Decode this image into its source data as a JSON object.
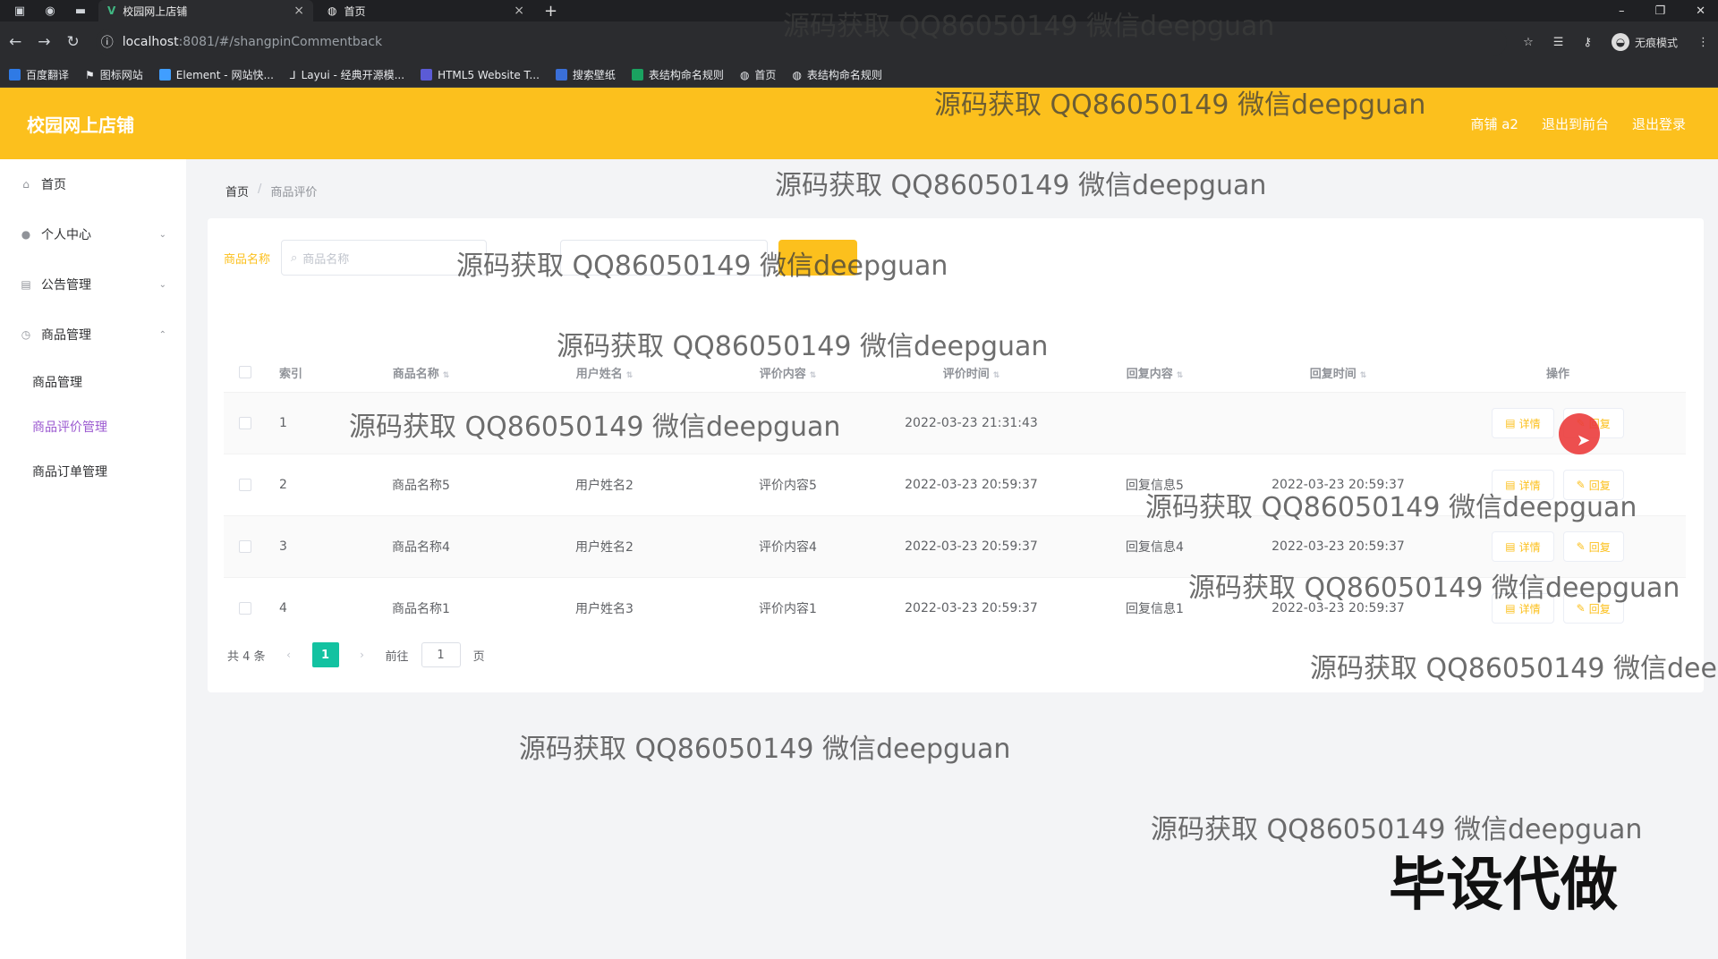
{
  "browser": {
    "tabs": [
      {
        "label": "校园网上店铺",
        "active": true
      },
      {
        "label": "首页",
        "active": false
      }
    ],
    "url_host": "localhost",
    "url_path": ":8081/#/shangpinCommentback",
    "incognito_label": "无痕模式",
    "bookmarks": [
      "百度翻译",
      "图标网站",
      "Element - 网站快...",
      "Layui - 经典开源模...",
      "HTML5 Website T...",
      "搜索壁纸",
      "表结构命名规则",
      "首页",
      "表结构命名规则"
    ]
  },
  "header": {
    "title": "校园网上店铺",
    "links": [
      "商铺 a2",
      "退出到前台",
      "退出登录"
    ]
  },
  "sidebar": {
    "items": [
      {
        "label": "首页",
        "icon": "home-icon"
      },
      {
        "label": "个人中心",
        "icon": "user-icon"
      },
      {
        "label": "公告管理",
        "icon": "notice-icon"
      },
      {
        "label": "商品管理",
        "icon": "clock-icon"
      }
    ],
    "subitems": [
      {
        "label": "商品管理",
        "active": false
      },
      {
        "label": "商品评价管理",
        "active": true
      },
      {
        "label": "商品订单管理",
        "active": false
      }
    ]
  },
  "breadcrumb": {
    "home": "首页",
    "current": "商品评价"
  },
  "search": {
    "label": "商品名称",
    "placeholder": "商品名称"
  },
  "table": {
    "headers": [
      "索引",
      "商品名称",
      "用户姓名",
      "评价内容",
      "评价时间",
      "回复内容",
      "回复时间",
      "操作"
    ],
    "rows": [
      {
        "idx": "1",
        "name": "",
        "user": "",
        "content": "",
        "time": "2022-03-23 21:31:43",
        "reply": "",
        "reply_time": ""
      },
      {
        "idx": "2",
        "name": "商品名称5",
        "user": "用户姓名2",
        "content": "评价内容5",
        "time": "2022-03-23 20:59:37",
        "reply": "回复信息5",
        "reply_time": "2022-03-23 20:59:37"
      },
      {
        "idx": "3",
        "name": "商品名称4",
        "user": "用户姓名2",
        "content": "评价内容4",
        "time": "2022-03-23 20:59:37",
        "reply": "回复信息4",
        "reply_time": "2022-03-23 20:59:37"
      },
      {
        "idx": "4",
        "name": "商品名称1",
        "user": "用户姓名3",
        "content": "评价内容1",
        "time": "2022-03-23 20:59:37",
        "reply": "回复信息1",
        "reply_time": "2022-03-23 20:59:37"
      }
    ],
    "detail_label": "详情",
    "reply_label": "回复"
  },
  "pager": {
    "total": "共 4 条",
    "page": "1",
    "goto": "前往",
    "goto_value": "1",
    "page_unit": "页"
  },
  "watermark": "源码获取 QQ86050149 微信deepguan",
  "watermark_cut": "源码获取 QQ86050149 微信deep",
  "big_watermark": "毕设代做",
  "colors": {
    "accent": "#fcc01d",
    "pager_active": "#13c2a1",
    "active_menu": "#9b59d0"
  }
}
